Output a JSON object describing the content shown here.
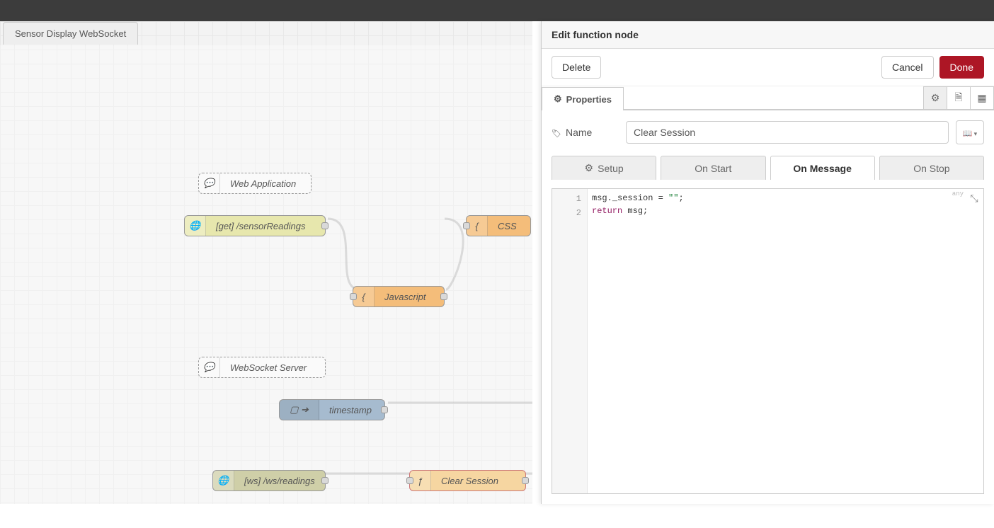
{
  "flow_tab": "Sensor Display WebSocket",
  "nodes": {
    "web_app": "Web Application",
    "http_in": "[get] /sensorReadings",
    "css": "CSS",
    "js": "Javascript",
    "ws_server": "WebSocket Server",
    "timestamp": "timestamp",
    "ws_in": "[ws] /ws/readings",
    "clear_session": "Clear Session"
  },
  "panel": {
    "title": "Edit function node",
    "delete": "Delete",
    "cancel": "Cancel",
    "done": "Done",
    "properties_tab": "Properties",
    "name_label": "Name",
    "name_value": "Clear Session",
    "tabs": {
      "setup": "Setup",
      "on_start": "On Start",
      "on_message": "On Message",
      "on_stop": "On Stop"
    },
    "code": {
      "line1_a": "msg._session = ",
      "line1_b": "\"\"",
      "line1_c": ";",
      "line2_kw": "return",
      "line2_rest": " msg;"
    },
    "gutter": [
      "1",
      "2"
    ]
  }
}
